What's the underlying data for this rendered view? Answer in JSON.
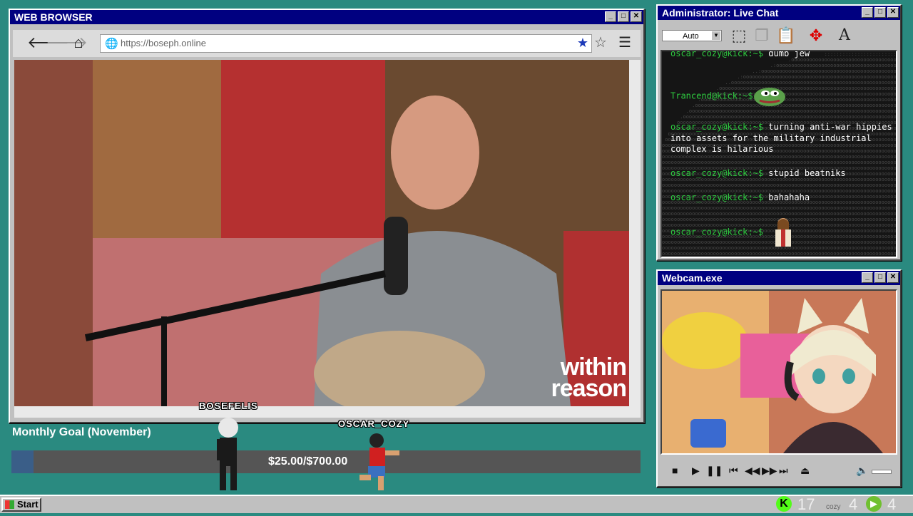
{
  "browser": {
    "title": "WEB BROWSER",
    "url": "https://boseph.online",
    "video_watermark_line1": "within",
    "video_watermark_line2": "reason"
  },
  "chat": {
    "title": "Administrator: Live Chat",
    "zoom_select": "Auto",
    "messages": [
      {
        "user": "oscar_cozy@kick:~$",
        "text": "dumb jew"
      },
      {
        "user": "Trancend@kick:~$",
        "text": ""
      },
      {
        "user": "oscar_cozy@kick:~$",
        "text": "turning anti-war hippies into assets for the military industrial complex is hilarious"
      },
      {
        "user": "oscar_cozy@kick:~$",
        "text": "stupid beatniks"
      },
      {
        "user": "oscar_cozy@kick:~$",
        "text": "bahahaha"
      },
      {
        "user": "oscar_cozy@kick:~$",
        "text": ""
      }
    ]
  },
  "webcam": {
    "title": "Webcam.exe"
  },
  "goal": {
    "title": "Monthly Goal (November)",
    "amount_text": "$25.00/$700.00",
    "progress_fraction": 0.0357
  },
  "sprites": {
    "left_name": "BOSEFELIS",
    "right_name": "OSCAR_COZY"
  },
  "taskbar": {
    "start_label": "Start",
    "tray_count_1": "17",
    "tray_label": "cozy",
    "tray_count_2": "4",
    "tray_count_3": "4"
  },
  "colors": {
    "titlebar": "#000080",
    "chat_user": "#2ecc40",
    "teal_bg": "#2a8a80"
  }
}
